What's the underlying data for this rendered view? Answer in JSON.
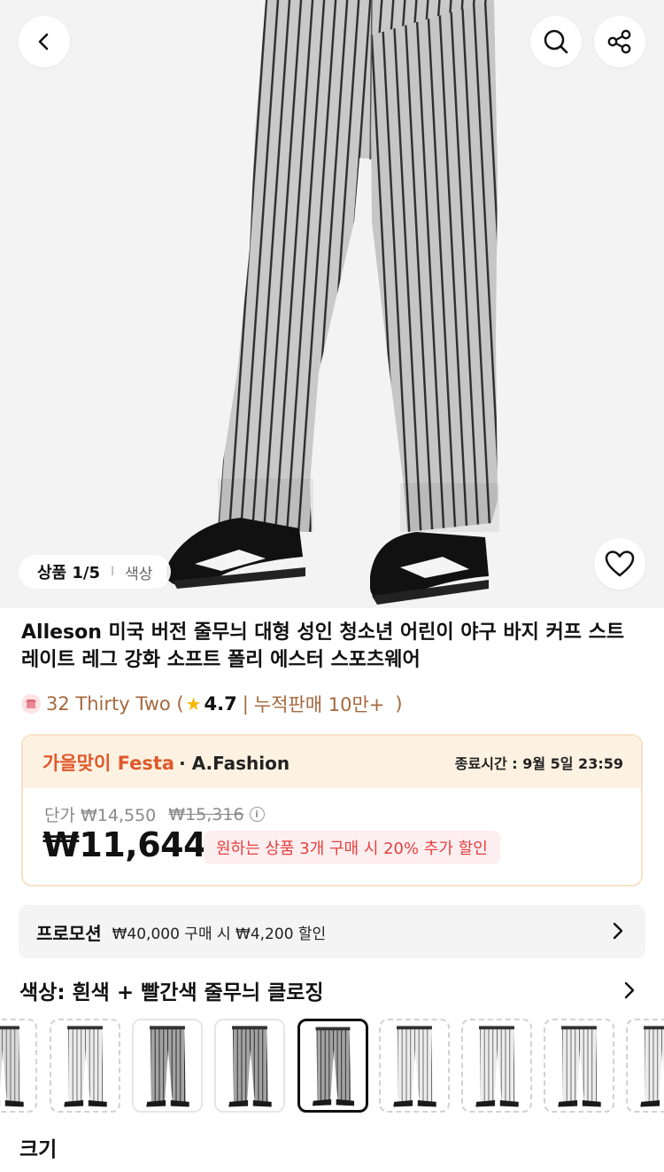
{
  "header": {
    "back_icon": "chevron-left-icon",
    "search_icon": "search-icon",
    "share_icon": "share-icon"
  },
  "gallery": {
    "index": "상품 1/5",
    "separator": "I",
    "tab": "색상",
    "wishlist_icon": "heart-icon"
  },
  "product": {
    "title": "Alleson 미국 버전 줄무늬 대형 성인 청소년 어린이 야구 바지 커프 스트레이트 레그 강화 소프트 폴리 에스터 스포츠웨어"
  },
  "store": {
    "name": "32 Thirty Two (",
    "rating": "4.7",
    "separator": "|",
    "sales": "누적판매 10만+",
    "close_paren": ")"
  },
  "festa": {
    "name": "가을맞이 Festa",
    "brand": "· A.Fashion",
    "end_time": "종료시간 : 9월 5일 23:59",
    "unit_label": "단가 ₩14,550",
    "original_price": "₩15,316",
    "info_icon": "i",
    "price": "₩11,644",
    "deal": "원하는 상품 3개 구매 시 20% 추가 할인"
  },
  "promotion": {
    "label": "프로모션",
    "text": "₩40,000 구매 시 ₩4,200 할인"
  },
  "color": {
    "title": "색상: 흰색 + 빨간색 줄무늬 클로징",
    "selected_index": 4,
    "options": [
      {
        "style": "light-gray",
        "border": "dashed"
      },
      {
        "style": "white",
        "border": "dashed"
      },
      {
        "style": "gray-dark",
        "border": "solid"
      },
      {
        "style": "gray-dark",
        "border": "solid"
      },
      {
        "style": "gray-dark",
        "border": "selected"
      },
      {
        "style": "white",
        "border": "dashed"
      },
      {
        "style": "white",
        "border": "dashed"
      },
      {
        "style": "white",
        "border": "dashed"
      },
      {
        "style": "white",
        "border": "dashed"
      }
    ]
  },
  "size": {
    "title": "크기"
  },
  "colors": {
    "accent_orange": "#e0592b",
    "store_brown": "#a5683c",
    "deal_red": "#e5413f",
    "festa_bg": "#fdf2e2",
    "star": "#f5b800"
  }
}
